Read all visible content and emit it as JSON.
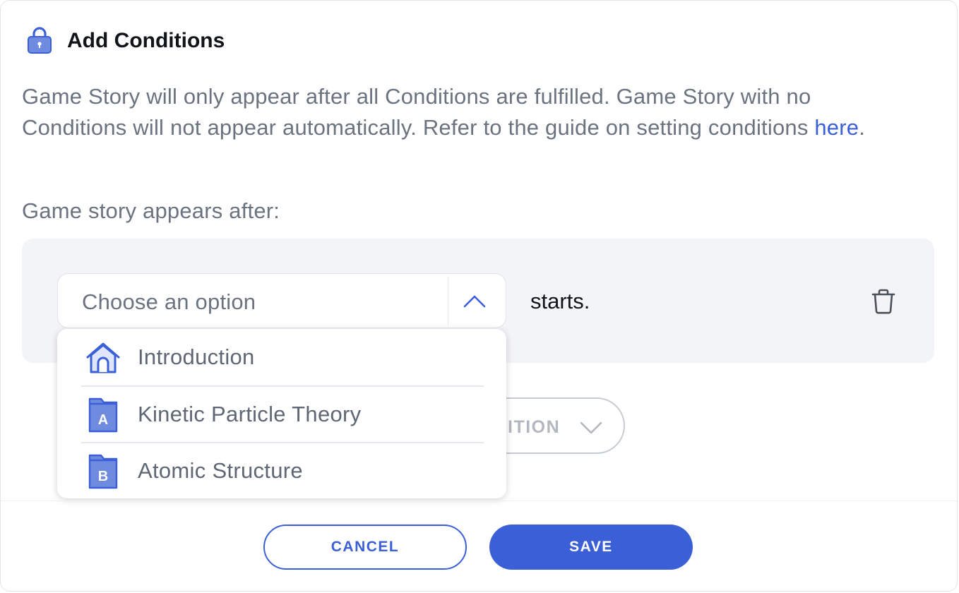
{
  "header": {
    "title": "Add Conditions",
    "icon": "lock-icon"
  },
  "description": {
    "text": "Game Story will only appear after all Conditions are fulfilled. Game Story with no Conditions will not appear automatically. Refer to the guide on setting conditions ",
    "link_text": "here",
    "suffix": "."
  },
  "condition": {
    "label": "Game story appears after:",
    "select_placeholder": "Choose an option",
    "suffix_text": "starts.",
    "delete_icon": "trash-icon"
  },
  "dropdown": {
    "options": [
      {
        "label": "Introduction",
        "icon": "home-icon"
      },
      {
        "label": "Kinetic Particle Theory",
        "icon": "folder-a-icon",
        "badge": "A"
      },
      {
        "label": "Atomic Structure",
        "icon": "folder-b-icon",
        "badge": "B"
      }
    ]
  },
  "add_condition": {
    "visible_label": "ITION"
  },
  "footer": {
    "cancel_label": "CANCEL",
    "save_label": "SAVE"
  },
  "colors": {
    "accent": "#3b5fd6",
    "icon_fill": "#6f8be0",
    "box_bg": "#f3f4f8"
  }
}
